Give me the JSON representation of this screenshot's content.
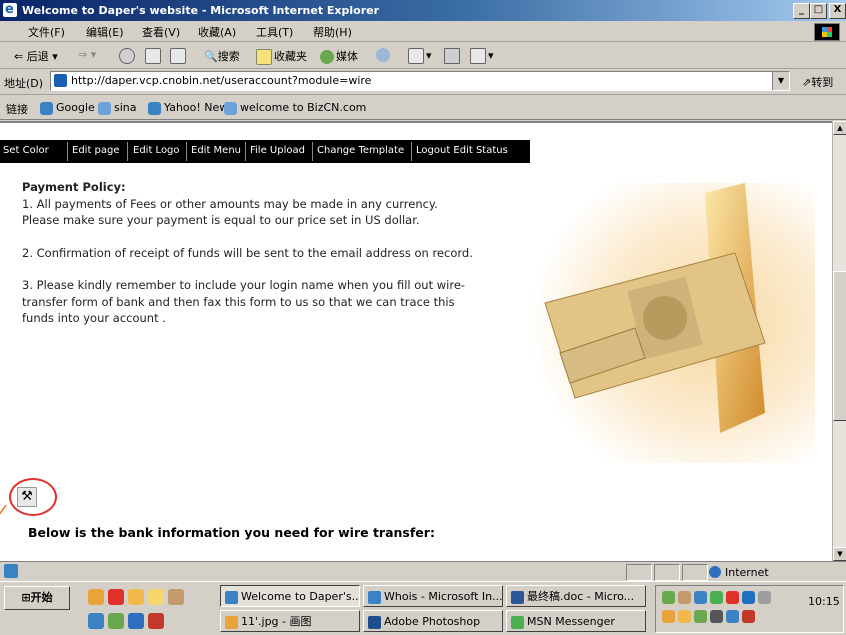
{
  "window": {
    "title": "Welcome to Daper's website - Microsoft Internet Explorer",
    "buttons": [
      "_",
      "□",
      "X"
    ]
  },
  "menubar": [
    "文件(F)",
    "编辑(E)",
    "查看(V)",
    "收藏(A)",
    "工具(T)",
    "帮助(H)"
  ],
  "toolbar": {
    "back": "后退",
    "search": "搜索",
    "favorites": "收藏夹",
    "media": "媒体"
  },
  "address": {
    "label": "地址(D)",
    "url": "http://daper.vcp.cnobin.net/useraccount?module=wire",
    "go": "转到"
  },
  "links": {
    "label": "链接",
    "items": [
      "Google",
      "sina",
      "Yahoo! News",
      "welcome to BizCN.com"
    ]
  },
  "editbar": [
    "Set Color",
    "Edit page",
    "Edit Logo",
    "Edit Menu",
    "File Upload",
    "Change Template",
    "Logout Edit Status"
  ],
  "content": {
    "heading": "Payment Policy:",
    "p1a": "1. All payments of Fees or other amounts may be made in any currency.",
    "p1b": "Please make sure your payment is equal to our price set in US dollar.",
    "p2": "2. Confirmation of receipt of funds will be sent to the email address on record.",
    "p3a": "3. Please kindly remember to include your login name when you fill out wire-",
    "p3b": "transfer form of bank and then fax this form to us so that we can trace this",
    "p3c": "funds into your account .",
    "bank_line": "Below is the bank information you need for wire transfer:"
  },
  "status": {
    "zone": "Internet"
  },
  "taskbar": {
    "start": "开始",
    "tasks": [
      {
        "label": "Welcome to Daper's...",
        "active": true
      },
      {
        "label": "Whois - Microsoft In...",
        "active": false
      },
      {
        "label": "最终稿.doc - Micro...",
        "active": false
      },
      {
        "label": "11'.jpg - 画图",
        "active": false
      },
      {
        "label": "Adobe Photoshop",
        "active": false
      },
      {
        "label": "MSN Messenger",
        "active": false
      }
    ],
    "clock": "10:15"
  }
}
